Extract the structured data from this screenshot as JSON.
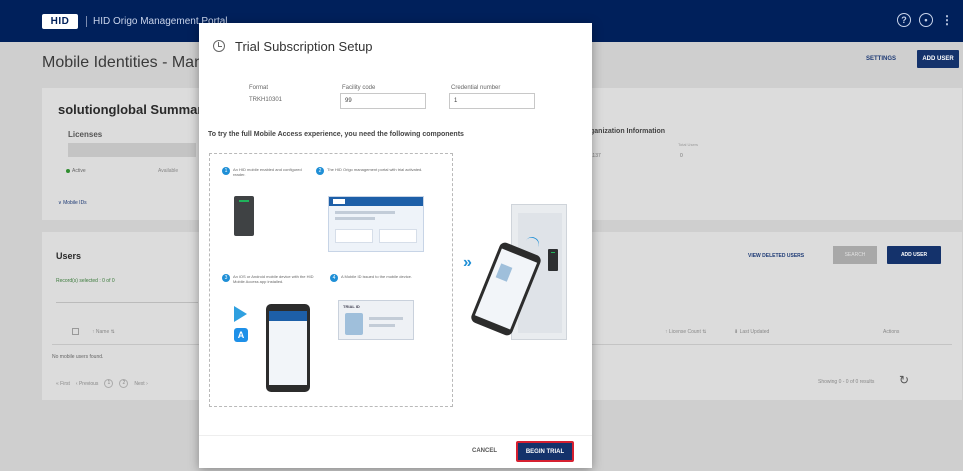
{
  "topbar": {
    "logo": "HID",
    "app_name": "HID Origo Management Portal",
    "help_icon": "?",
    "account_icon": "user-circle-icon",
    "menu_icon": "⋮"
  },
  "background": {
    "page_title": "Mobile Identities - Man",
    "settings_label": "SETTINGS",
    "add_user_label": "ADD USER",
    "summary_title": "solutionglobal Summar",
    "licenses_label": "Licenses",
    "active_label": "Active",
    "available_label": "Available",
    "mobile_ids_label": "Mobile IDs",
    "org_info_title": "ganization Information",
    "org_value_1": "1137",
    "org_label_2": "Total Users",
    "org_value_2": "0",
    "users_title": "Users",
    "records_selected": "Record(s) selected : 0 of 0",
    "view_deleted_label": "VIEW DELETED USERS",
    "search_label": "SEARCH",
    "add_user_2_label": "ADD USER",
    "columns": {
      "name": "Name",
      "license": "License Count",
      "updated": "Last Updated",
      "actions": "Actions"
    },
    "no_users": "No mobile users found.",
    "pager": {
      "first": "« First",
      "previous": "‹ Previous",
      "page1": "1",
      "page2": "2",
      "next": "Next ›"
    },
    "showing": "Showing 0 - 0 of 0 results"
  },
  "modal": {
    "title": "Trial Subscription Setup",
    "icon": "clock-icon",
    "format_label": "Format",
    "format_value": "TRKH10301",
    "facility_label": "Facility code",
    "facility_value": "99",
    "credential_label": "Credential number",
    "credential_value": "1",
    "intro": "To try the full Mobile Access experience, you need the following components",
    "steps": [
      {
        "n": "1",
        "text": "An HID mobile enabled and configured reader."
      },
      {
        "n": "2",
        "text": "The HID Origo management portal with trial activated."
      },
      {
        "n": "3",
        "text": "An iOS or Android mobile device with the HID Mobile Access app installed."
      },
      {
        "n": "4",
        "text": "A Mobile ID issued to the mobile device."
      }
    ],
    "portal_logo": "HID",
    "trial_card_label": "TRIAL ID",
    "appstore_glyph": "A",
    "chevrons": "»",
    "cancel_label": "CANCEL",
    "begin_trial_label": "BEGIN TRIAL"
  }
}
